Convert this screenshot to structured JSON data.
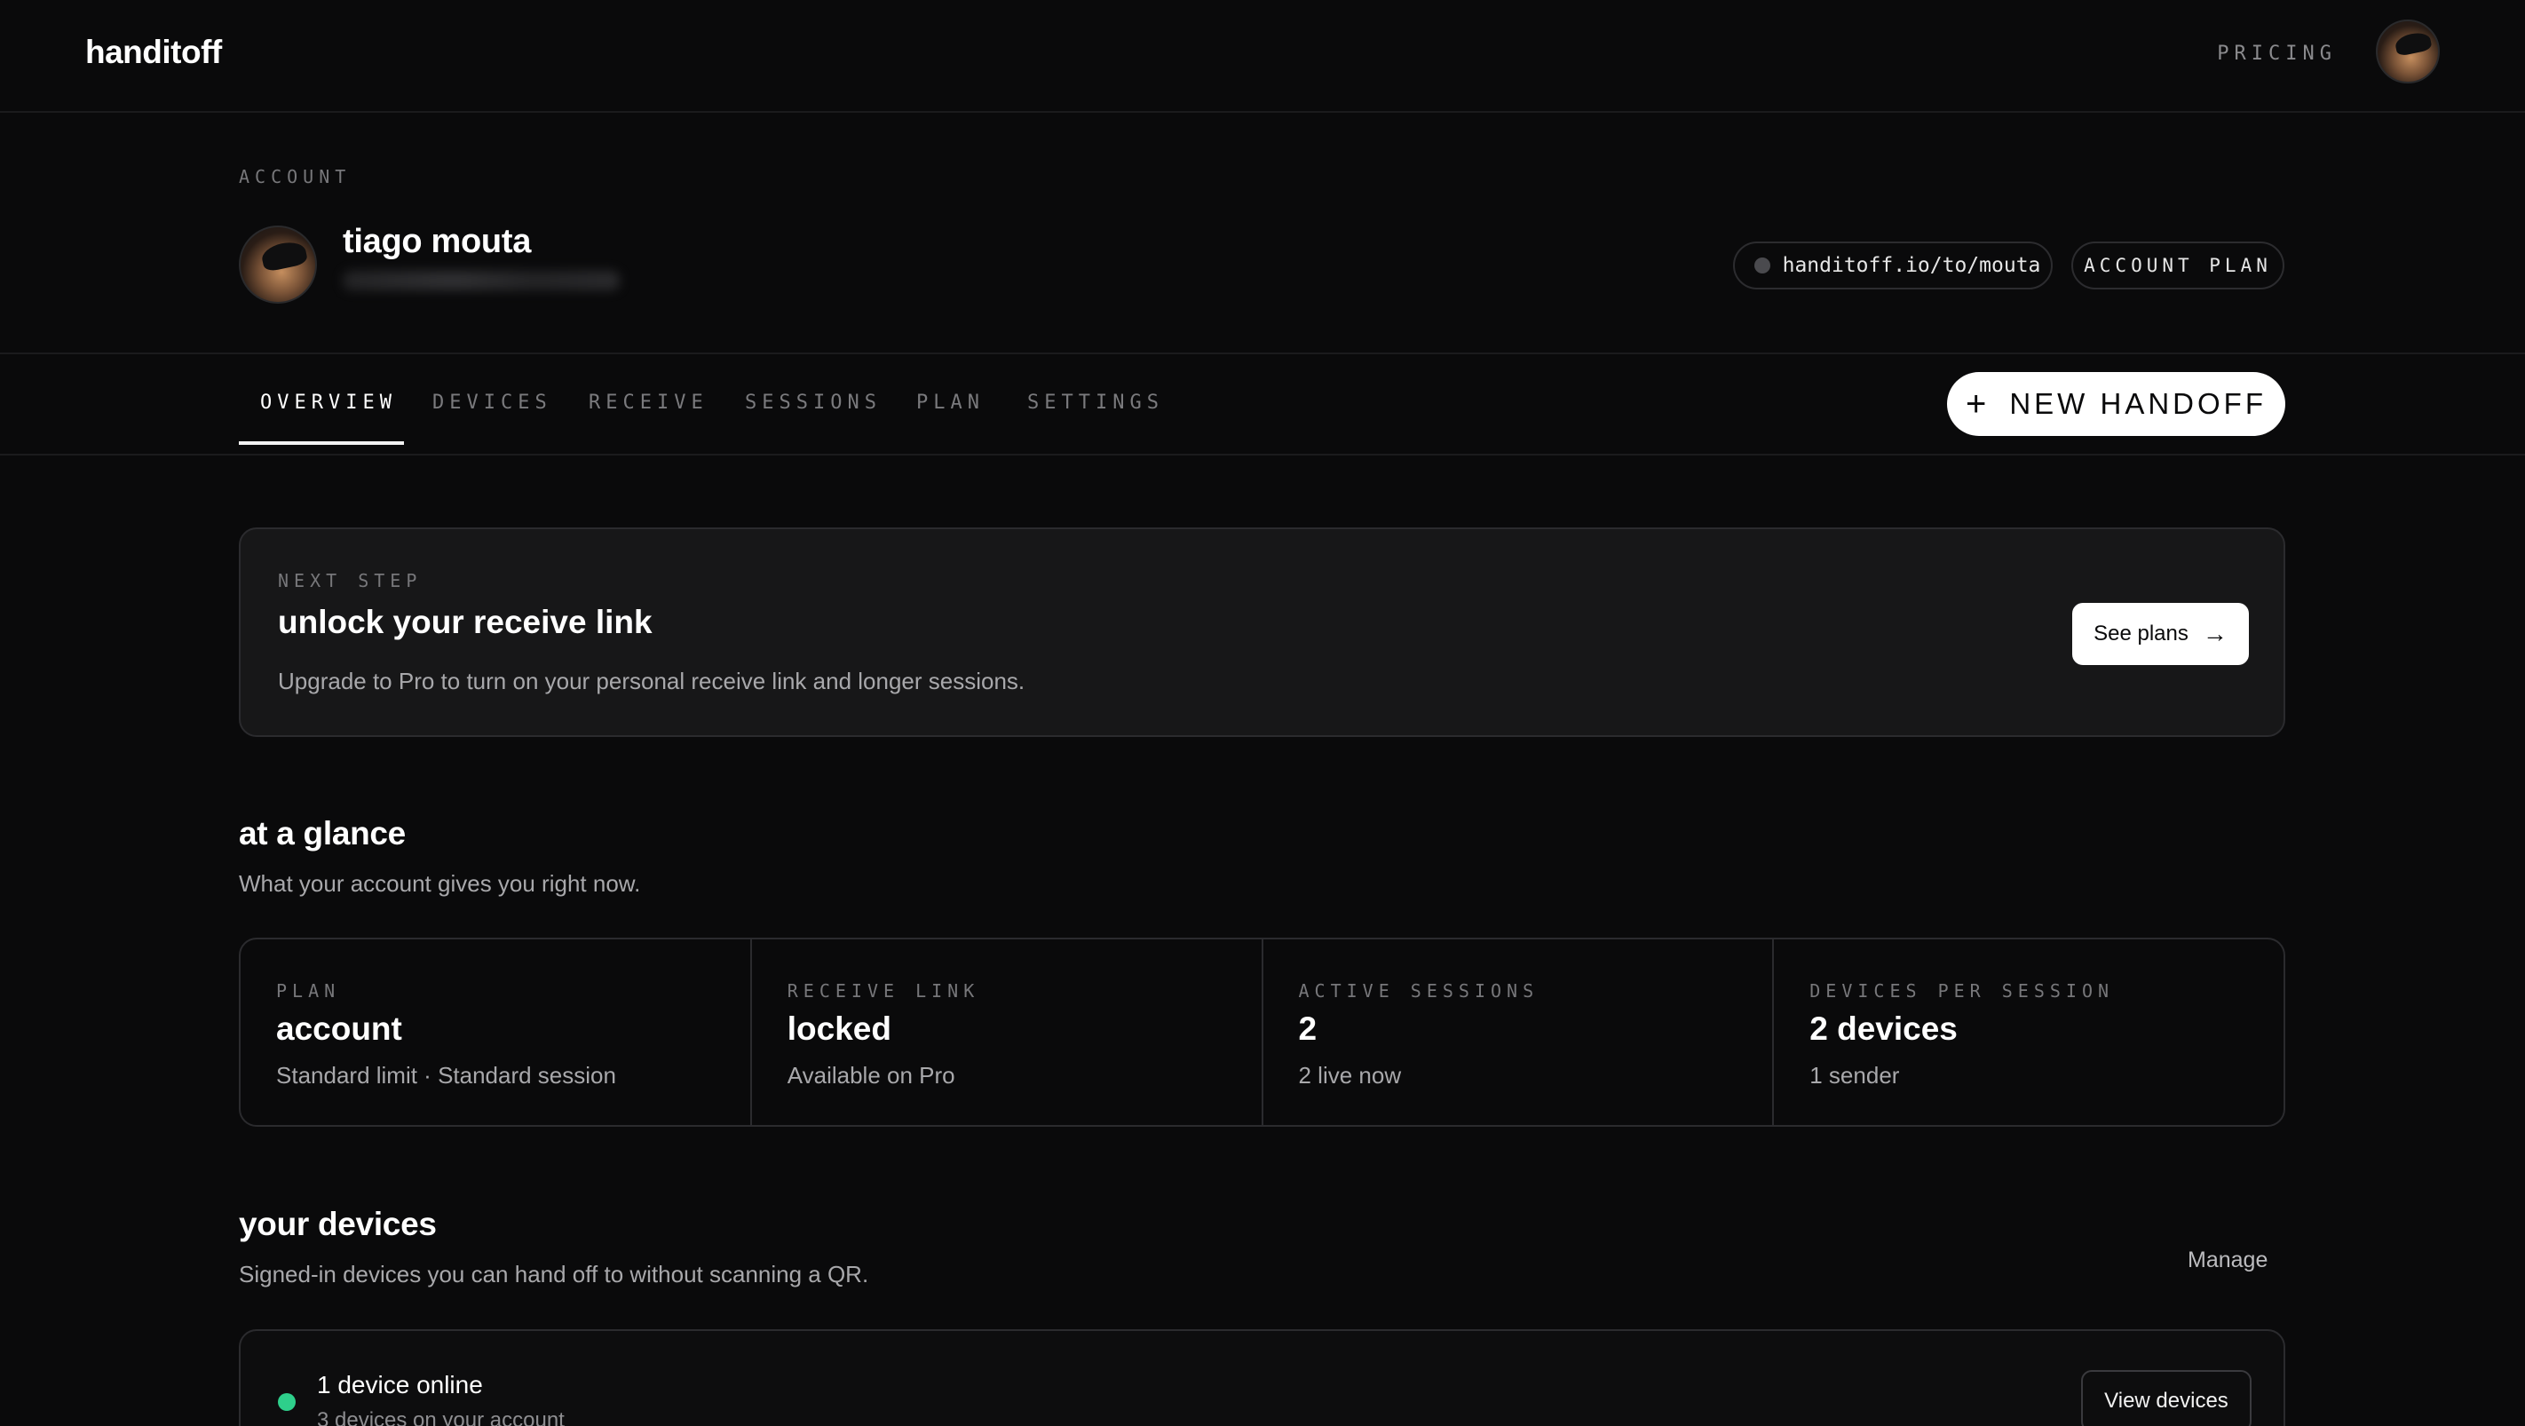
{
  "app": {
    "logo": "handitoff"
  },
  "topnav": {
    "pricing": "PRICING"
  },
  "account": {
    "eyebrow": "ACCOUNT",
    "name": "tiago mouta",
    "link": "handitoff.io/to/mouta",
    "plan_label": "ACCOUNT PLAN"
  },
  "tabs": [
    {
      "label": "OVERVIEW",
      "active": true
    },
    {
      "label": "DEVICES"
    },
    {
      "label": "RECEIVE"
    },
    {
      "label": "SESSIONS"
    },
    {
      "label": "PLAN"
    },
    {
      "label": "SETTINGS"
    }
  ],
  "new_handoff": {
    "plus": "+",
    "label": "NEW HANDOFF"
  },
  "next_step": {
    "eyebrow": "NEXT STEP",
    "title": "unlock your receive link",
    "description": "Upgrade to Pro to turn on your personal receive link and longer sessions.",
    "button": "See plans",
    "button_icon": "→"
  },
  "glance": {
    "title": "at a glance",
    "subtitle": "What your account gives you right now.",
    "stats": [
      {
        "label": "PLAN",
        "value": "account",
        "note": "Standard limit · Standard session"
      },
      {
        "label": "RECEIVE LINK",
        "value": "locked",
        "note": "Available on Pro"
      },
      {
        "label": "ACTIVE SESSIONS",
        "value": "2",
        "note": "2 live now"
      },
      {
        "label": "DEVICES PER SESSION",
        "value": "2 devices",
        "note": "1 sender"
      }
    ]
  },
  "devices": {
    "title": "your devices",
    "subtitle": "Signed-in devices you can hand off to without scanning a QR.",
    "manage": "Manage",
    "online_title": "1 device online",
    "online_sub": "3 devices on your account",
    "view_button": "View devices",
    "online_color": "#2ecf8b"
  }
}
